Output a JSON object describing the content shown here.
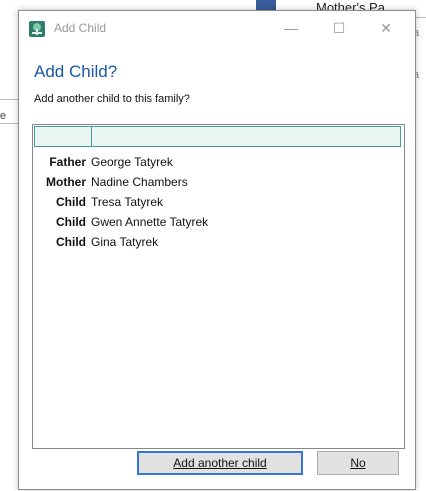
{
  "background": {
    "column_header": "Mother's Pa",
    "fragment_1": "a",
    "fragment_2": "a",
    "fragment_3": "e"
  },
  "dialog": {
    "title": "Add Child",
    "heading": "Add Child?",
    "message": "Add another child to this family?",
    "controls": {
      "minimize": "—",
      "maximize": "☐",
      "close": "✕"
    },
    "members": [
      {
        "role": "Father",
        "name": "George Tatyrek"
      },
      {
        "role": "Mother",
        "name": "Nadine Chambers"
      },
      {
        "role": "Child",
        "name": "Tresa Tatyrek"
      },
      {
        "role": "Child",
        "name": "Gwen Annette Tatyrek"
      },
      {
        "role": "Child",
        "name": "Gina Tatyrek"
      }
    ],
    "buttons": {
      "add_another": "Add another child",
      "no": "No"
    }
  },
  "colors": {
    "heading": "#1a56a8",
    "header_fill": "#e8f5f3",
    "header_border": "#4e9d93",
    "default_button_border": "#3779d2"
  },
  "icons": {
    "app": "family-tree-app-icon"
  }
}
